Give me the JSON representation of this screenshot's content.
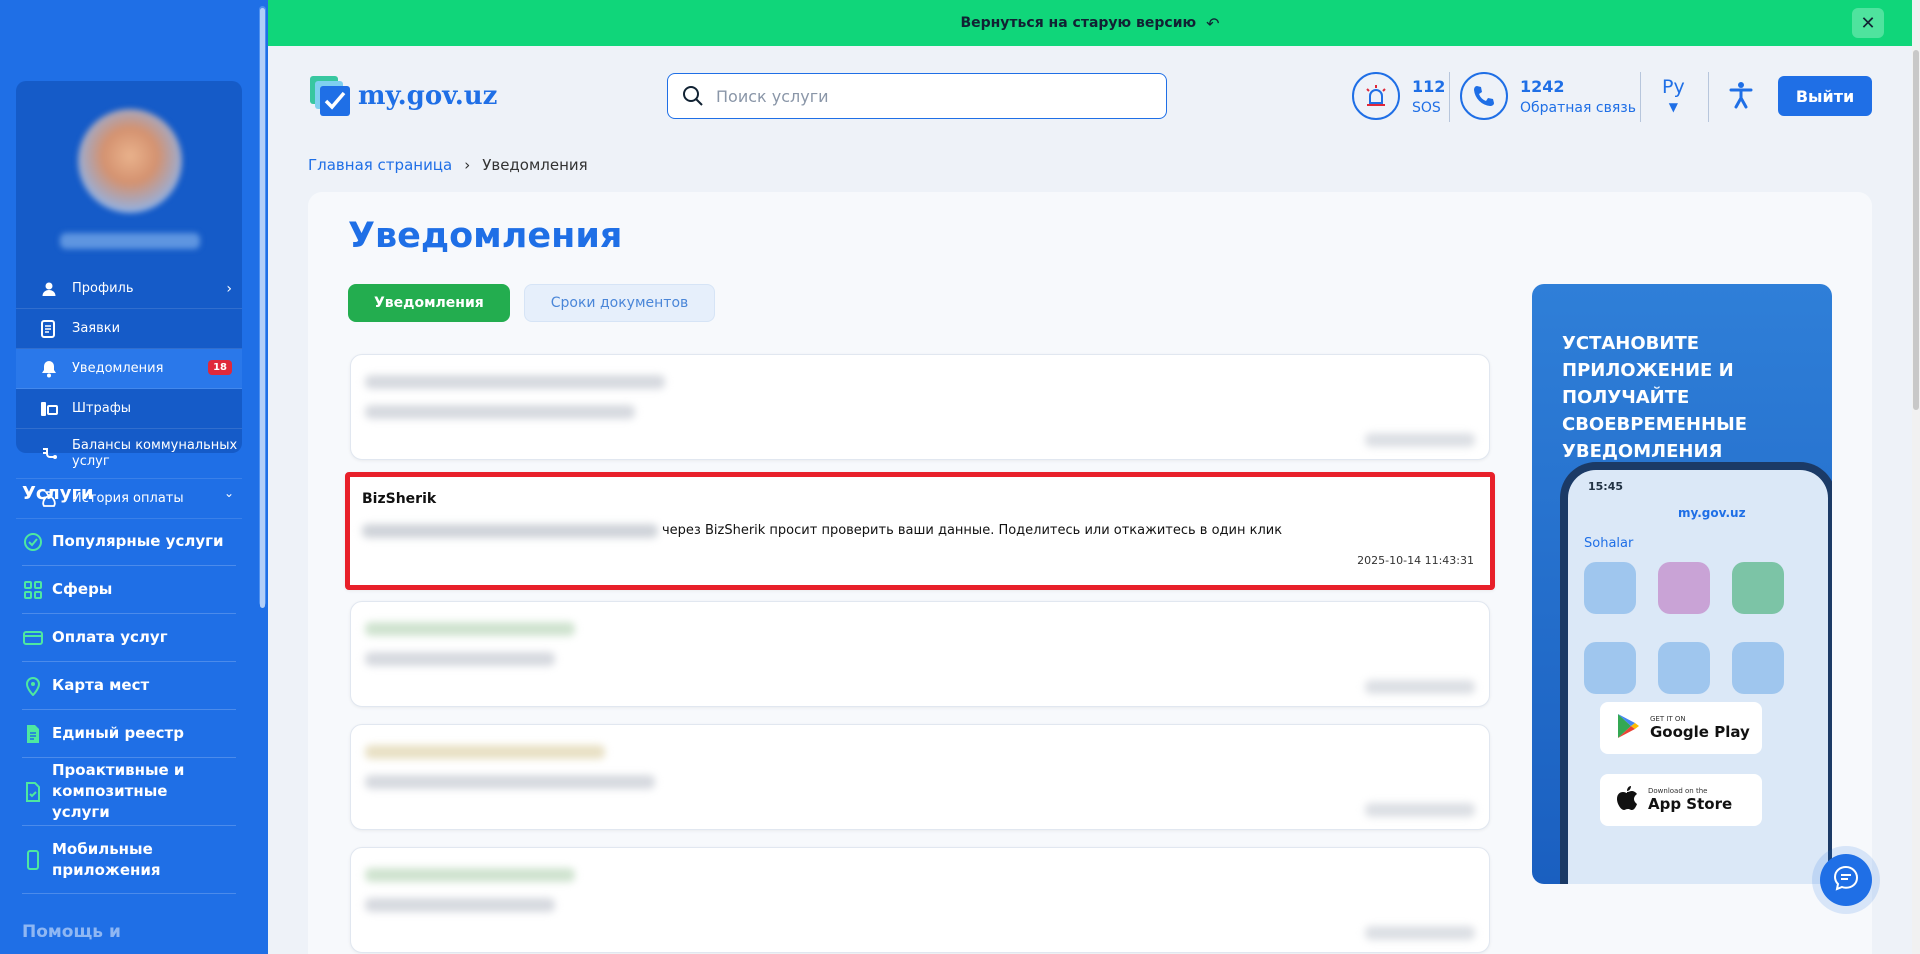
{
  "banner": {
    "text": "Вернуться на старую версию"
  },
  "header": {
    "logo": "my.gov.uz",
    "search_placeholder": "Поиск услуги",
    "sos": {
      "number": "112",
      "label": "SOS"
    },
    "callback": {
      "number": "1242",
      "label": "Обратная связь"
    },
    "language": "Ру",
    "logout": "Выйти"
  },
  "sidebar": {
    "menu": [
      {
        "label": "Профиль"
      },
      {
        "label": "Заявки"
      },
      {
        "label": "Уведомления",
        "badge": "18"
      },
      {
        "label": "Штрафы"
      },
      {
        "label": "Балансы коммунальных услуг"
      },
      {
        "label": "История оплаты"
      }
    ],
    "services_title": "Услуги",
    "services": [
      {
        "label": "Популярные услуги"
      },
      {
        "label": "Сферы"
      },
      {
        "label": "Оплата услуг"
      },
      {
        "label": "Карта мест"
      },
      {
        "label": "Единый реестр"
      },
      {
        "label": "Проактивные и композитные услуги"
      },
      {
        "label": "Мобильные приложения"
      }
    ],
    "help_partial": "Помощь и"
  },
  "breadcrumb": {
    "home": "Главная страница",
    "current": "Уведомления"
  },
  "page": {
    "title": "Уведомления",
    "tabs": [
      {
        "label": "Уведомления",
        "active": true
      },
      {
        "label": "Сроки документов",
        "active": false
      }
    ]
  },
  "notification": {
    "title": "BizSherik",
    "body": "через BizSherik просит проверить ваши данные. Поделитесь или откажитесь в один клик",
    "date": "2025-10-14 11:43:31"
  },
  "promo": {
    "text": "Установите приложение и получайте своевременные уведомления",
    "phone": {
      "time": "15:45",
      "logo": "my.gov.uz",
      "section": "Sohalar"
    },
    "google_play": {
      "small": "GET IT ON",
      "big": "Google Play"
    },
    "app_store": {
      "small": "Download on the",
      "big": "App Store"
    }
  },
  "colors": {
    "primary": "#1f6fe6",
    "banner": "#10d67a",
    "active_tab": "#23ad4f",
    "highlight": "#e8202a",
    "badge": "#e0283a"
  }
}
